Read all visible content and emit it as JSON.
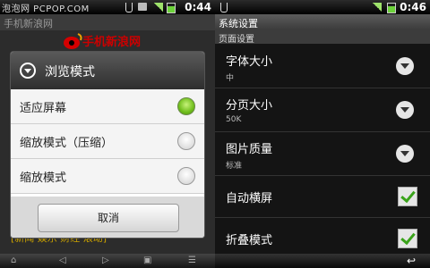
{
  "left": {
    "watermark": "泡泡网 PCPOP.COM",
    "status_time": "0:44",
    "browser_title": "手机新浪网",
    "logo_text": "手机新浪网",
    "browser_links": "[新闻·娱乐·财经·滚动]",
    "dialog": {
      "title": "浏览模式",
      "options": [
        {
          "label": "适应屏幕",
          "selected": true
        },
        {
          "label": "缩放模式（压缩）",
          "selected": false
        },
        {
          "label": "缩放模式",
          "selected": false
        }
      ],
      "cancel_label": "取消"
    },
    "nav_icons": [
      "home-icon",
      "back-icon",
      "forward-icon",
      "windows-icon",
      "menu-icon"
    ]
  },
  "right": {
    "status_time": "0:46",
    "title": "系统设置",
    "section": "页面设置",
    "settings": [
      {
        "title": "字体大小",
        "value": "中",
        "control": "dropdown"
      },
      {
        "title": "分页大小",
        "value": "50K",
        "control": "dropdown"
      },
      {
        "title": "图片质量",
        "value": "标准",
        "control": "dropdown"
      },
      {
        "title": "自动横屏",
        "value": "",
        "control": "checkbox",
        "checked": true
      },
      {
        "title": "折叠模式",
        "value": "",
        "control": "checkbox",
        "checked": true
      }
    ]
  },
  "colors": {
    "accent_green": "#6fbd1b",
    "link_yellow": "#c8a000",
    "logo_red": "#cc0000"
  }
}
